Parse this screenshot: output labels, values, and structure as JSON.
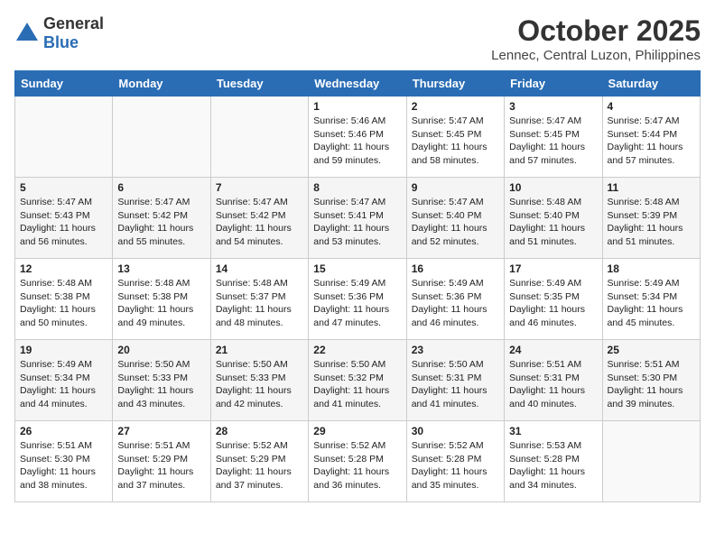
{
  "header": {
    "logo_general": "General",
    "logo_blue": "Blue",
    "month": "October 2025",
    "location": "Lennec, Central Luzon, Philippines"
  },
  "weekdays": [
    "Sunday",
    "Monday",
    "Tuesday",
    "Wednesday",
    "Thursday",
    "Friday",
    "Saturday"
  ],
  "weeks": [
    [
      {
        "day": "",
        "info": ""
      },
      {
        "day": "",
        "info": ""
      },
      {
        "day": "",
        "info": ""
      },
      {
        "day": "1",
        "info": "Sunrise: 5:46 AM\nSunset: 5:46 PM\nDaylight: 11 hours\nand 59 minutes."
      },
      {
        "day": "2",
        "info": "Sunrise: 5:47 AM\nSunset: 5:45 PM\nDaylight: 11 hours\nand 58 minutes."
      },
      {
        "day": "3",
        "info": "Sunrise: 5:47 AM\nSunset: 5:45 PM\nDaylight: 11 hours\nand 57 minutes."
      },
      {
        "day": "4",
        "info": "Sunrise: 5:47 AM\nSunset: 5:44 PM\nDaylight: 11 hours\nand 57 minutes."
      }
    ],
    [
      {
        "day": "5",
        "info": "Sunrise: 5:47 AM\nSunset: 5:43 PM\nDaylight: 11 hours\nand 56 minutes."
      },
      {
        "day": "6",
        "info": "Sunrise: 5:47 AM\nSunset: 5:42 PM\nDaylight: 11 hours\nand 55 minutes."
      },
      {
        "day": "7",
        "info": "Sunrise: 5:47 AM\nSunset: 5:42 PM\nDaylight: 11 hours\nand 54 minutes."
      },
      {
        "day": "8",
        "info": "Sunrise: 5:47 AM\nSunset: 5:41 PM\nDaylight: 11 hours\nand 53 minutes."
      },
      {
        "day": "9",
        "info": "Sunrise: 5:47 AM\nSunset: 5:40 PM\nDaylight: 11 hours\nand 52 minutes."
      },
      {
        "day": "10",
        "info": "Sunrise: 5:48 AM\nSunset: 5:40 PM\nDaylight: 11 hours\nand 51 minutes."
      },
      {
        "day": "11",
        "info": "Sunrise: 5:48 AM\nSunset: 5:39 PM\nDaylight: 11 hours\nand 51 minutes."
      }
    ],
    [
      {
        "day": "12",
        "info": "Sunrise: 5:48 AM\nSunset: 5:38 PM\nDaylight: 11 hours\nand 50 minutes."
      },
      {
        "day": "13",
        "info": "Sunrise: 5:48 AM\nSunset: 5:38 PM\nDaylight: 11 hours\nand 49 minutes."
      },
      {
        "day": "14",
        "info": "Sunrise: 5:48 AM\nSunset: 5:37 PM\nDaylight: 11 hours\nand 48 minutes."
      },
      {
        "day": "15",
        "info": "Sunrise: 5:49 AM\nSunset: 5:36 PM\nDaylight: 11 hours\nand 47 minutes."
      },
      {
        "day": "16",
        "info": "Sunrise: 5:49 AM\nSunset: 5:36 PM\nDaylight: 11 hours\nand 46 minutes."
      },
      {
        "day": "17",
        "info": "Sunrise: 5:49 AM\nSunset: 5:35 PM\nDaylight: 11 hours\nand 46 minutes."
      },
      {
        "day": "18",
        "info": "Sunrise: 5:49 AM\nSunset: 5:34 PM\nDaylight: 11 hours\nand 45 minutes."
      }
    ],
    [
      {
        "day": "19",
        "info": "Sunrise: 5:49 AM\nSunset: 5:34 PM\nDaylight: 11 hours\nand 44 minutes."
      },
      {
        "day": "20",
        "info": "Sunrise: 5:50 AM\nSunset: 5:33 PM\nDaylight: 11 hours\nand 43 minutes."
      },
      {
        "day": "21",
        "info": "Sunrise: 5:50 AM\nSunset: 5:33 PM\nDaylight: 11 hours\nand 42 minutes."
      },
      {
        "day": "22",
        "info": "Sunrise: 5:50 AM\nSunset: 5:32 PM\nDaylight: 11 hours\nand 41 minutes."
      },
      {
        "day": "23",
        "info": "Sunrise: 5:50 AM\nSunset: 5:31 PM\nDaylight: 11 hours\nand 41 minutes."
      },
      {
        "day": "24",
        "info": "Sunrise: 5:51 AM\nSunset: 5:31 PM\nDaylight: 11 hours\nand 40 minutes."
      },
      {
        "day": "25",
        "info": "Sunrise: 5:51 AM\nSunset: 5:30 PM\nDaylight: 11 hours\nand 39 minutes."
      }
    ],
    [
      {
        "day": "26",
        "info": "Sunrise: 5:51 AM\nSunset: 5:30 PM\nDaylight: 11 hours\nand 38 minutes."
      },
      {
        "day": "27",
        "info": "Sunrise: 5:51 AM\nSunset: 5:29 PM\nDaylight: 11 hours\nand 37 minutes."
      },
      {
        "day": "28",
        "info": "Sunrise: 5:52 AM\nSunset: 5:29 PM\nDaylight: 11 hours\nand 37 minutes."
      },
      {
        "day": "29",
        "info": "Sunrise: 5:52 AM\nSunset: 5:28 PM\nDaylight: 11 hours\nand 36 minutes."
      },
      {
        "day": "30",
        "info": "Sunrise: 5:52 AM\nSunset: 5:28 PM\nDaylight: 11 hours\nand 35 minutes."
      },
      {
        "day": "31",
        "info": "Sunrise: 5:53 AM\nSunset: 5:28 PM\nDaylight: 11 hours\nand 34 minutes."
      },
      {
        "day": "",
        "info": ""
      }
    ]
  ]
}
